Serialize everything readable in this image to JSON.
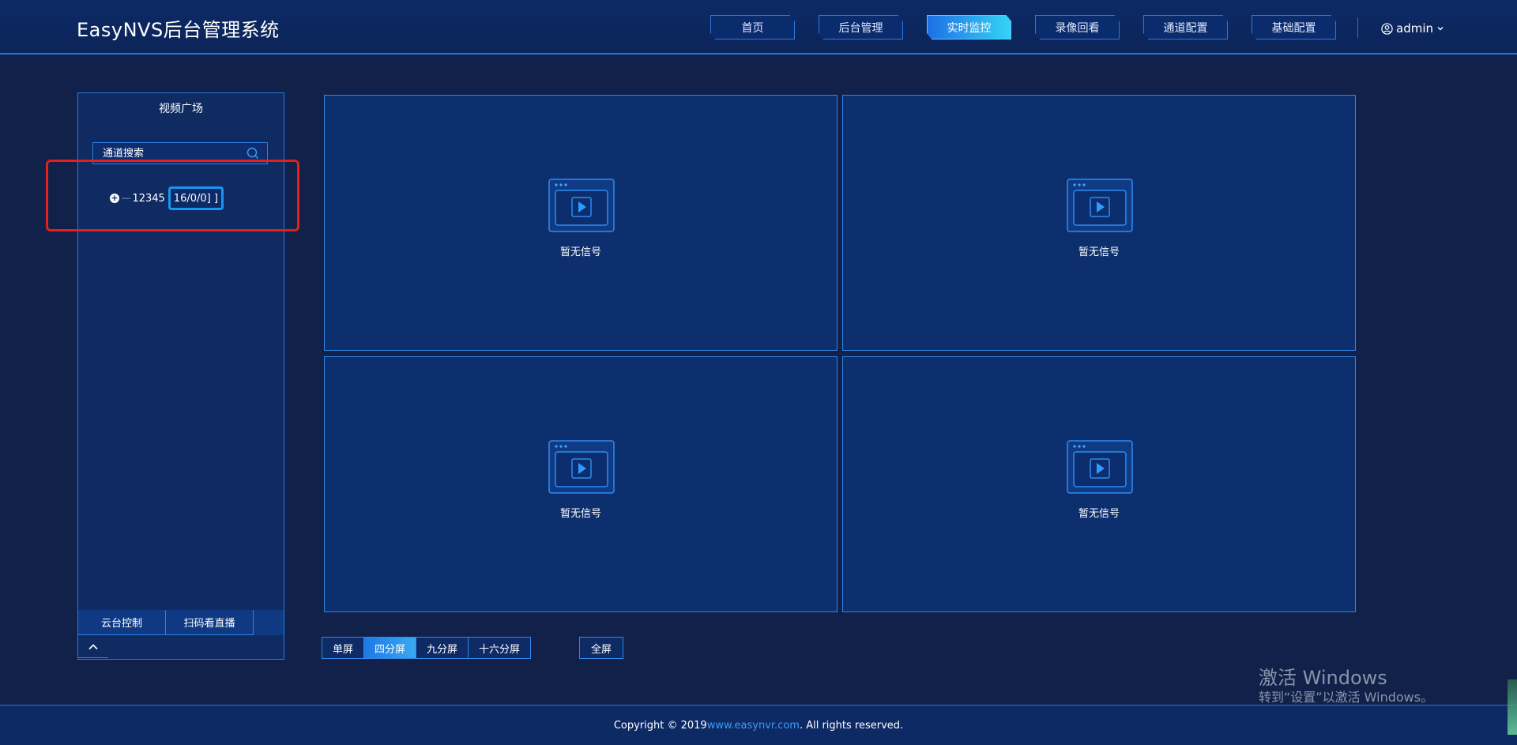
{
  "app": {
    "title": "EasyNVS后台管理系统"
  },
  "nav": {
    "tabs": [
      {
        "label": "首页"
      },
      {
        "label": "后台管理"
      },
      {
        "label": "实时监控"
      },
      {
        "label": "录像回看"
      },
      {
        "label": "通道配置"
      },
      {
        "label": "基础配置"
      }
    ],
    "active_tab": "实时监控",
    "user": {
      "name": "admin"
    }
  },
  "sidebar": {
    "title": "视频广场",
    "search": {
      "placeholder": "通道搜索"
    },
    "tree": [
      {
        "name": "12345",
        "count": "16/0/0] ]",
        "expand_icon": "plus-circle-icon"
      }
    ],
    "bottom_tabs": [
      {
        "label": "云台控制"
      },
      {
        "label": "扫码看直播"
      }
    ]
  },
  "video": {
    "panels": [
      {
        "status": "暂无信号"
      },
      {
        "status": "暂无信号"
      },
      {
        "status": "暂无信号"
      },
      {
        "status": "暂无信号"
      }
    ]
  },
  "layouts": {
    "buttons": [
      {
        "label": "单屏"
      },
      {
        "label": "四分屏"
      },
      {
        "label": "九分屏"
      },
      {
        "label": "十六分屏"
      }
    ],
    "active": "四分屏",
    "fullscreen_label": "全屏"
  },
  "watermark": {
    "line1": "激活 Windows",
    "line2": "转到“设置”以激活 Windows。"
  },
  "footer": {
    "prefix": "Copyright © 2019 ",
    "link": "www.easynvr.com",
    "suffix": ". All rights reserved."
  },
  "colors": {
    "background": "#11214a",
    "accent": "#1f78d6",
    "active_tab_start": "#1e6fe6",
    "active_tab_end": "#35d3f5",
    "highlight": "#e3201b"
  }
}
